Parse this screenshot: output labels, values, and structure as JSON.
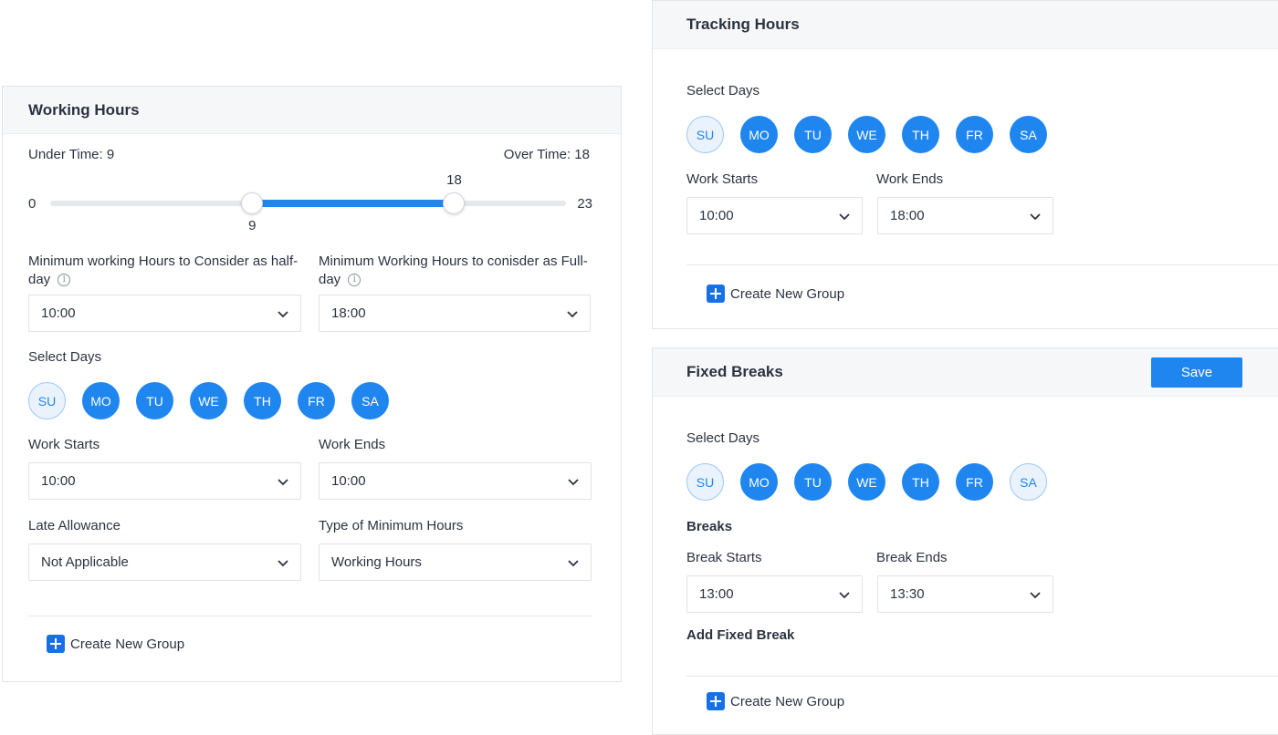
{
  "working_hours": {
    "title": "Working Hours",
    "under_time_label": "Under Time: 9",
    "over_time_label": "Over Time: 18",
    "slider": {
      "min": 0,
      "max": 23,
      "low": 9,
      "high": 18,
      "min_label": "0",
      "max_label": "23",
      "low_label": "9",
      "high_label": "18"
    },
    "half_day": {
      "label": "Minimum working Hours to Consider as half-day",
      "value": "10:00"
    },
    "full_day": {
      "label": "Minimum Working Hours to conisder as Full-day",
      "value": "18:00"
    },
    "select_days_label": "Select Days",
    "days": [
      {
        "label": "SU",
        "selected": false
      },
      {
        "label": "MO",
        "selected": true
      },
      {
        "label": "TU",
        "selected": true
      },
      {
        "label": "WE",
        "selected": true
      },
      {
        "label": "TH",
        "selected": true
      },
      {
        "label": "FR",
        "selected": true
      },
      {
        "label": "SA",
        "selected": true
      }
    ],
    "work_starts": {
      "label": "Work Starts",
      "value": "10:00"
    },
    "work_ends": {
      "label": "Work Ends",
      "value": "10:00"
    },
    "late_allowance": {
      "label": "Late Allowance",
      "value": "Not Applicable"
    },
    "min_hours_type": {
      "label": "Type of Minimum Hours",
      "value": "Working Hours"
    },
    "create_group": "Create New Group"
  },
  "tracking_hours": {
    "title": "Tracking Hours",
    "select_days_label": "Select Days",
    "days": [
      {
        "label": "SU",
        "selected": false
      },
      {
        "label": "MO",
        "selected": true
      },
      {
        "label": "TU",
        "selected": true
      },
      {
        "label": "WE",
        "selected": true
      },
      {
        "label": "TH",
        "selected": true
      },
      {
        "label": "FR",
        "selected": true
      },
      {
        "label": "SA",
        "selected": true
      }
    ],
    "work_starts": {
      "label": "Work Starts",
      "value": "10:00"
    },
    "work_ends": {
      "label": "Work Ends",
      "value": "18:00"
    },
    "create_group": "Create New Group"
  },
  "fixed_breaks": {
    "title": "Fixed Breaks",
    "save_label": "Save",
    "select_days_label": "Select Days",
    "days": [
      {
        "label": "SU",
        "selected": false
      },
      {
        "label": "MO",
        "selected": true
      },
      {
        "label": "TU",
        "selected": true
      },
      {
        "label": "WE",
        "selected": true
      },
      {
        "label": "TH",
        "selected": true
      },
      {
        "label": "FR",
        "selected": true
      },
      {
        "label": "SA",
        "selected": false
      }
    ],
    "breaks_label": "Breaks",
    "break_starts": {
      "label": "Break Starts",
      "value": "13:00"
    },
    "break_ends": {
      "label": "Break Ends",
      "value": "13:30"
    },
    "add_fixed_break": "Add Fixed Break",
    "create_group": "Create New Group"
  },
  "colors": {
    "accent": "#1f86f0",
    "accent_dark": "#1770e6",
    "day_off_bg": "#eaf3fd",
    "track": "#e6e8eb"
  }
}
